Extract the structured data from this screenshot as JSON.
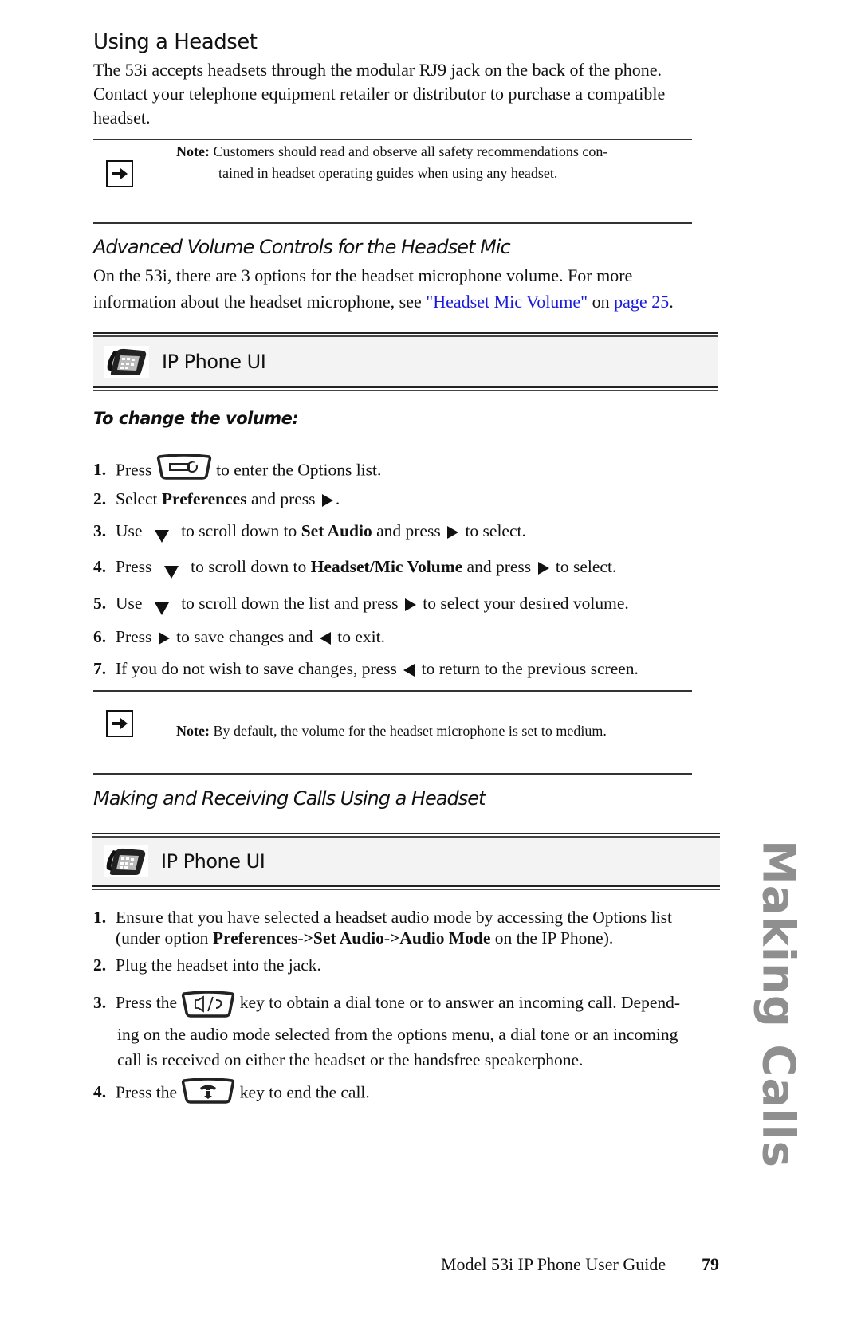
{
  "section": {
    "title": "Using a Headset",
    "intro": "The 53i accepts headsets through the modular RJ9 jack on the back of the phone. Contact your telephone equipment retailer or distributor to purchase a compatible headset.",
    "note_label": "Note:",
    "note_line1": "Customers should read and observe all safety recommendations con-",
    "note_line2": "tained in headset operating guides when using any headset.",
    "note_icon": "arrow-right-icon"
  },
  "advanced": {
    "title": "Advanced Volume Controls for the Headset Mic",
    "line1": "On the 53i, there are 3 options for the headset microphone volume. For more",
    "line2_prefix": "information about the headset microphone, see ",
    "link_text": "\"Headset Mic Volume\"",
    "mid_text": " on ",
    "page_link": "page 25",
    "suffix": ".",
    "link_color": "#1a1adb",
    "ui_box_label": "IP Phone UI",
    "ui_box_icon": "desk-phone-icon",
    "procedure_title": "To change the volume:",
    "steps": [
      {
        "num": "1.",
        "parts": [
          "Press ",
          "{options-key}",
          " to enter the Options list."
        ]
      },
      {
        "num": "2.",
        "parts": [
          "Select ",
          "**Preferences**",
          " and press ",
          "{right}",
          "."
        ]
      },
      {
        "num": "3.",
        "parts": [
          "Use ",
          "{down}",
          " to scroll down to ",
          "**Set Audio**",
          " and press ",
          "{right}",
          " to select."
        ]
      },
      {
        "num": "4.",
        "parts": [
          "Press ",
          "{down}",
          " to scroll down to ",
          "**Headset/Mic Volume**",
          " and press ",
          "{right}",
          " to select."
        ]
      },
      {
        "num": "5.",
        "parts": [
          "Use ",
          "{down}",
          " to scroll down the list and press ",
          "{right}",
          " to select your desired volume."
        ]
      },
      {
        "num": "6.",
        "parts": [
          "Press ",
          "{right}",
          " to save changes and ",
          "{left}",
          " to exit."
        ]
      },
      {
        "num": "7.",
        "parts": [
          "If you do not wish to save changes, press ",
          "{left}",
          " to return to the previous screen."
        ]
      }
    ],
    "note_label": "Note:",
    "note_text": "By default, the volume for the headset microphone is set to medium.",
    "note_icon": "arrow-right-icon"
  },
  "calls": {
    "title": "Making and Receiving Calls Using a Headset",
    "ui_box_label": "IP Phone UI",
    "ui_box_icon": "desk-phone-icon",
    "step1_num": "1.",
    "step1_line1": "Ensure that you have selected a headset audio mode by accessing the Options list",
    "step1_line2_prefix": "(under option ",
    "step1_line2_bold": "Preferences->Set Audio->Audio Mode",
    "step1_line2_suffix": " on the IP Phone).",
    "step2_num": "2.",
    "step2_text": "Plug the headset into the jack.",
    "step3_num": "3.",
    "step3_prefix": "Press the ",
    "step3_after": " key to obtain a dial tone or to answer an incoming call. Depend-",
    "step3_line2": "ing on the audio mode selected from the options menu, a dial tone or an incoming",
    "step3_line3": "call is received on either the headset or the handsfree speakerphone.",
    "step4_num": "4.",
    "step4_prefix": "Press the ",
    "step4_after": " key to end the call."
  },
  "side_tab": "Making Calls",
  "footer": {
    "guide_title": "Model 53i IP Phone User Guide",
    "page_number": "79"
  }
}
